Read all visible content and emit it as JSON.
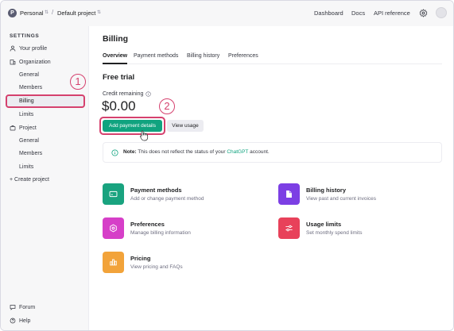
{
  "topbar": {
    "org_initial": "P",
    "org_name": "Personal",
    "separator": "/",
    "project_name": "Default project",
    "links": [
      "Dashboard",
      "Docs",
      "API reference"
    ]
  },
  "sidebar": {
    "section_label": "SETTINGS",
    "your_profile": "Your profile",
    "organization": "Organization",
    "org_items": [
      "General",
      "Members",
      "Billing",
      "Limits"
    ],
    "project": "Project",
    "project_items": [
      "General",
      "Members",
      "Limits"
    ],
    "create_project": "+ Create project",
    "forum": "Forum",
    "help": "Help"
  },
  "callouts": [
    "1",
    "2"
  ],
  "main": {
    "title": "Billing",
    "tabs": [
      "Overview",
      "Payment methods",
      "Billing history",
      "Preferences"
    ],
    "active_tab": "Overview",
    "section_title": "Free trial",
    "credit_label": "Credit remaining",
    "credit_value": "$0.00",
    "primary_button": "Add payment details",
    "secondary_button": "View usage",
    "note_bold": "Note:",
    "note_text": " This does not reflect the status of your ",
    "note_link": "ChatGPT",
    "note_end": " account.",
    "cards": [
      {
        "title": "Payment methods",
        "desc": "Add or change payment method",
        "color": "#19a37f"
      },
      {
        "title": "Billing history",
        "desc": "View past and current invoices",
        "color": "#7c3fe4"
      },
      {
        "title": "Preferences",
        "desc": "Manage billing information",
        "color": "#d63fc8"
      },
      {
        "title": "Usage limits",
        "desc": "Set monthly spend limits",
        "color": "#e8415a"
      },
      {
        "title": "Pricing",
        "desc": "View pricing and FAQs",
        "color": "#f2a33a"
      }
    ]
  },
  "colors": {
    "accent": "#10a37f",
    "highlight": "#d5416e"
  }
}
